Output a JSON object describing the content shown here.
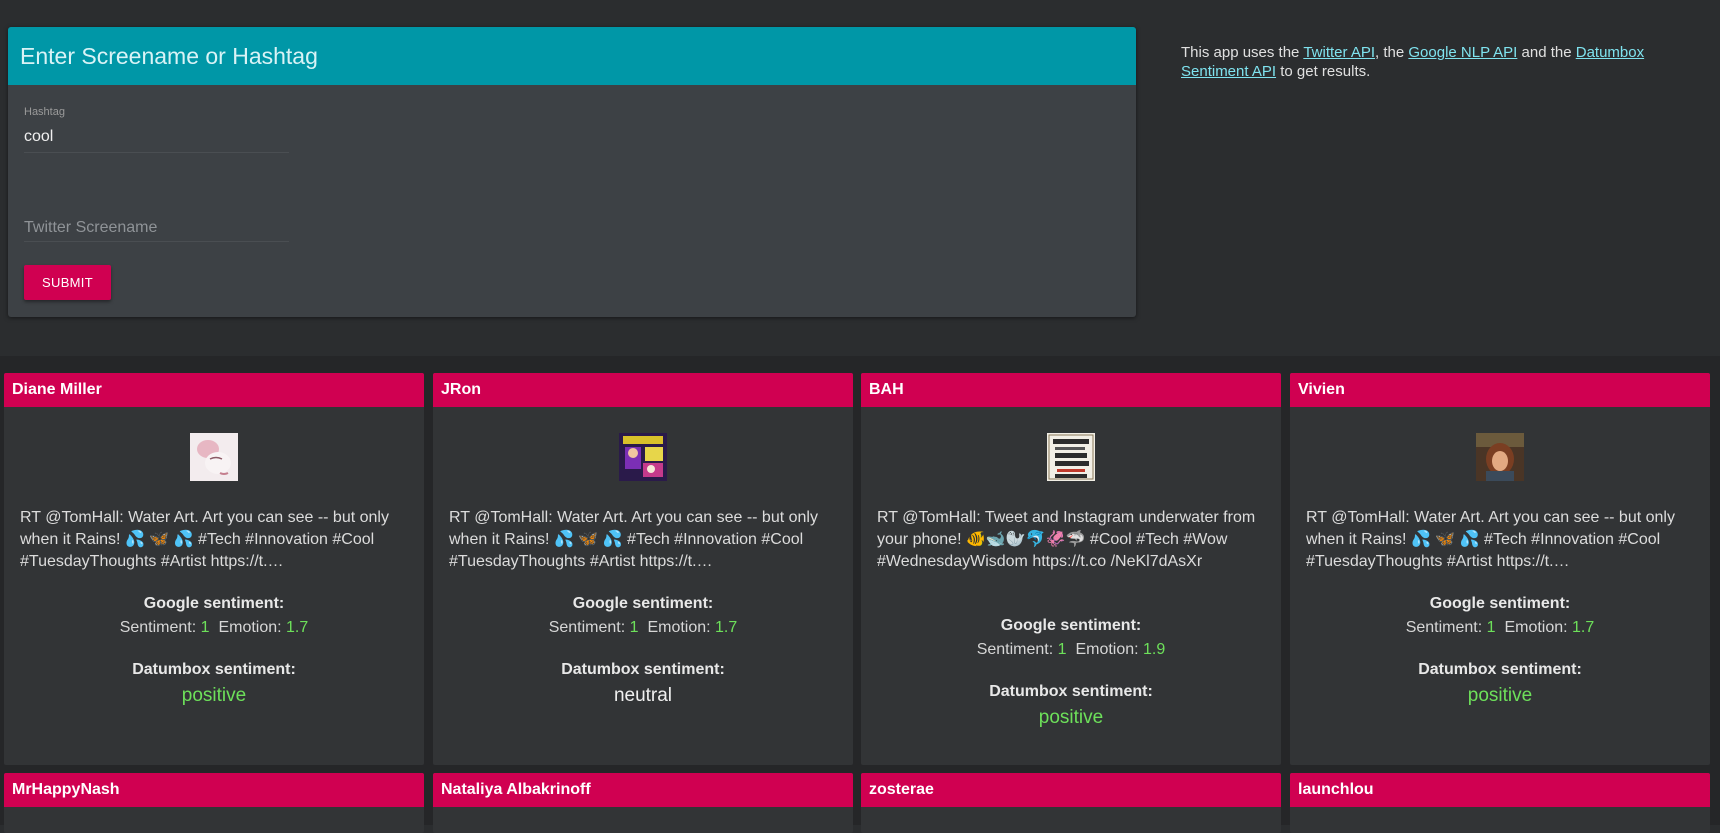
{
  "form": {
    "header": "Enter Screename or Hashtag",
    "hashtag_label": "Hashtag",
    "hashtag_value": "cool",
    "screenname_placeholder": "Twitter Screename",
    "submit_label": "SUBMIT"
  },
  "about": {
    "t1": "This app uses the ",
    "link1": "Twitter API",
    "t2": ", the ",
    "link2": "Google NLP API",
    "t3": " and the ",
    "link3": "Datumbox Sentiment API",
    "t4": " to get results."
  },
  "labels": {
    "google": "Google sentiment:",
    "sentiment": "Sentiment:",
    "emotion": "Emotion:",
    "datumbox": "Datumbox sentiment:"
  },
  "cards": [
    {
      "name": "Diane Miller",
      "tweet": "RT @TomHall: Water Art. Art you can see -- but only when it Rains! 💦 🦋 💦 #Tech #Innovation #Cool #TuesdayThoughts #Artist https://t.…",
      "sentiment": "1",
      "emotion": "1.7",
      "datumbox": "positive"
    },
    {
      "name": "JRon",
      "tweet": "RT @TomHall: Water Art. Art you can see -- but only when it Rains! 💦 🦋 💦 #Tech #Innovation #Cool #TuesdayThoughts #Artist https://t.…",
      "sentiment": "1",
      "emotion": "1.7",
      "datumbox": "neutral"
    },
    {
      "name": "BAH",
      "tweet": "RT @TomHall: Tweet and Instagram underwater from your phone! 🐠🐋🦭🐬🦑🦈 #Cool #Tech #Wow #WednesdayWisdom https://t.co /NeKl7dAsXr",
      "sentiment": "1",
      "emotion": "1.9",
      "datumbox": "positive"
    },
    {
      "name": "Vivien",
      "tweet": "RT @TomHall: Water Art. Art you can see -- but only when it Rains! 💦 🦋 💦 #Tech #Innovation #Cool #TuesdayThoughts #Artist https://t.…",
      "sentiment": "1",
      "emotion": "1.7",
      "datumbox": "positive"
    },
    {
      "name": "MrHappyNash"
    },
    {
      "name": "Nataliya Albakrinoff"
    },
    {
      "name": "zosterae"
    },
    {
      "name": "launchlou"
    }
  ],
  "colors": {
    "accent": "#d00051",
    "header": "#0097a7",
    "positive": "#6de05a"
  }
}
